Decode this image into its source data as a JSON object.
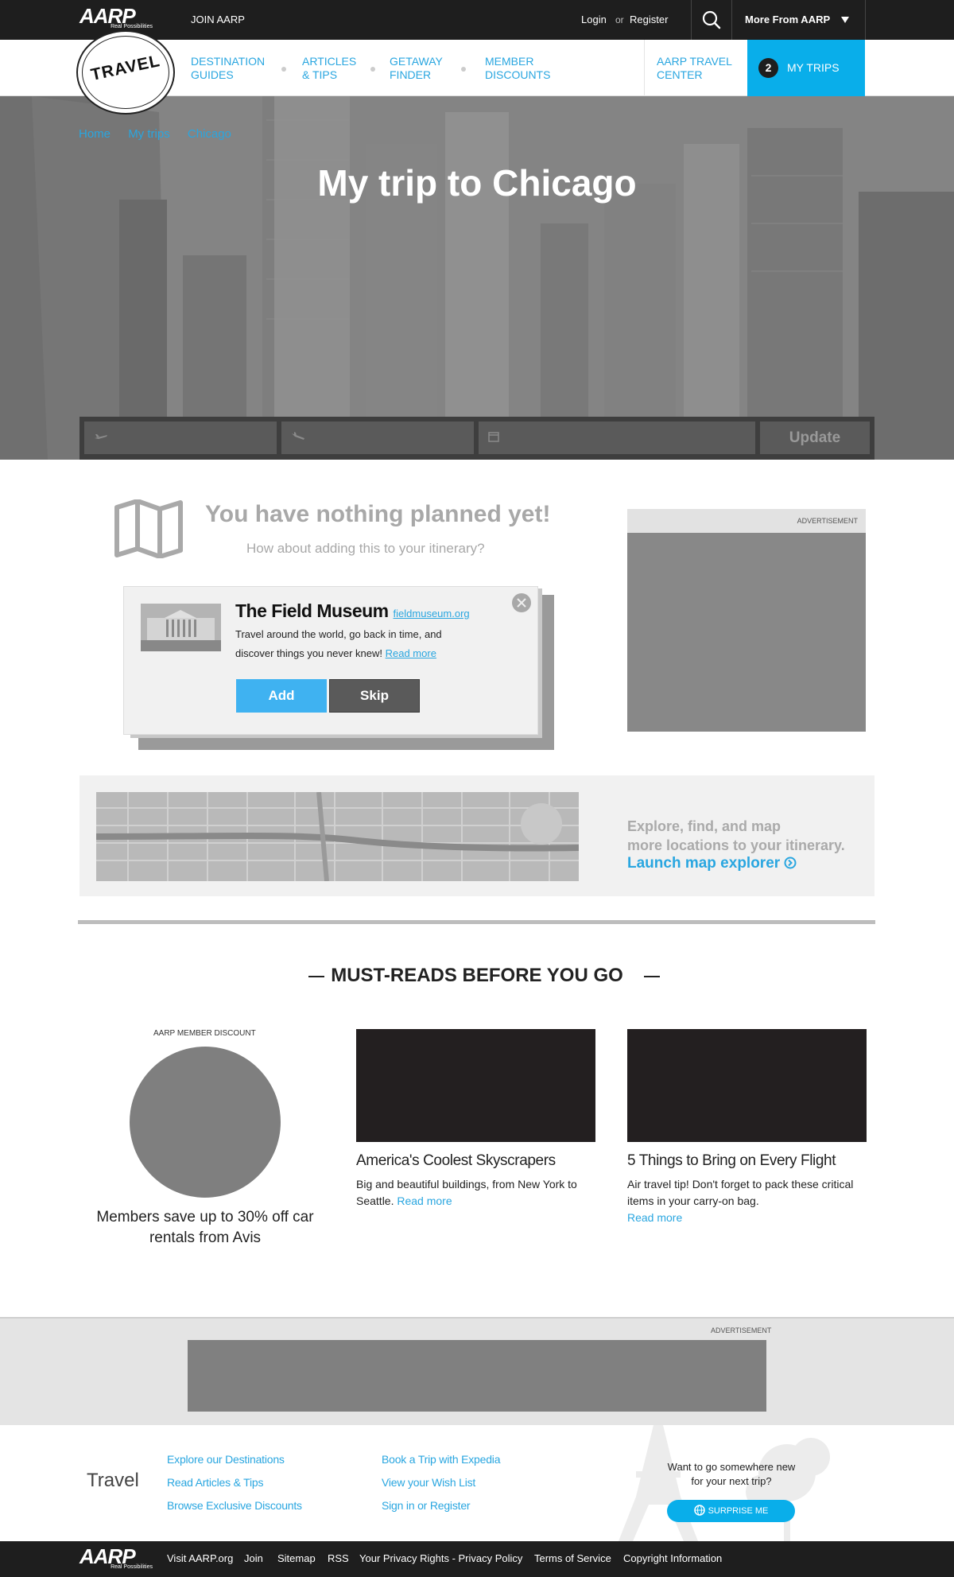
{
  "header": {
    "logo": "AARP",
    "logo_tagline": "Real Possibilities",
    "join": "JOIN AARP",
    "login": "Login",
    "or": "or",
    "register": "Register",
    "more": "More From AARP",
    "icons": {
      "search": "search-icon",
      "dropdown": "caret-down-icon"
    }
  },
  "nav": {
    "badge": "TRAVEL",
    "items": [
      {
        "line1": "DESTINATION",
        "line2": "GUIDES"
      },
      {
        "line1": "ARTICLES",
        "line2": "& TIPS"
      },
      {
        "line1": "GETAWAY",
        "line2": "FINDER"
      },
      {
        "line1": "MEMBER",
        "line2": "DISCOUNTS"
      }
    ],
    "travel_center": {
      "line1": "AARP TRAVEL",
      "line2": "CENTER"
    },
    "my_trips": {
      "count": "2",
      "label": "MY TRIPS"
    }
  },
  "hero": {
    "breadcrumbs": [
      "Home",
      "My trips",
      "Chicago"
    ],
    "title": "My trip to Chicago",
    "search": {
      "update_label": "Update",
      "icons": [
        "departure-plane-icon",
        "arrival-plane-icon",
        "calendar-icon"
      ]
    }
  },
  "planner": {
    "empty_title": "You have nothing planned yet!",
    "empty_subtitle": "How about adding this to your itinerary?",
    "suggestion": {
      "name": "The Field Museum",
      "site": "fieldmuseum.org",
      "description": "Travel around the world, go back in time, and discover things you never knew!",
      "read_more": "Read more",
      "add_label": "Add",
      "skip_label": "Skip"
    }
  },
  "ad": {
    "label": "ADVERTISEMENT"
  },
  "map_promo": {
    "line1": "Explore, find, and map",
    "line2": "more locations to your itinerary.",
    "link": "Launch map explorer"
  },
  "must_reads": {
    "title": "MUST-READS BEFORE YOU GO",
    "discount": {
      "label": "AARP MEMBER DISCOUNT",
      "text": "Members save up to 30% off car rentals from Avis"
    },
    "articles": [
      {
        "title": "America's Coolest Skyscrapers",
        "description": "Big and beautiful buildings, from New York to Seattle.",
        "read_more": "Read more"
      },
      {
        "title": "5 Things to Bring on Every Flight",
        "description": "Air travel tip! Don't forget to pack these critical items in your carry-on bag.",
        "read_more": "Read more"
      }
    ]
  },
  "bottom_ad": {
    "label": "ADVERTISEMENT"
  },
  "footer": {
    "brand": "Travel",
    "col1": [
      "Explore our Destinations",
      "Read Articles & Tips",
      "Browse Exclusive Discounts"
    ],
    "col2": [
      "Book a Trip with Expedia",
      "View your Wish List",
      "Sign in or Register"
    ],
    "question": "Want to go somewhere new for your next trip?",
    "surprise": "SURPRISE ME",
    "bottom_links": [
      "Visit AARP.org",
      "Join",
      "Sitemap",
      "RSS",
      "Your Privacy Rights - Privacy Policy",
      "Terms of Service",
      "Copyright Information"
    ]
  },
  "colors": {
    "accent": "#29a6e0",
    "my_trips_bg": "#09aeea",
    "add_button": "#3fb2f1",
    "dark_bar": "#1e1e1e"
  }
}
